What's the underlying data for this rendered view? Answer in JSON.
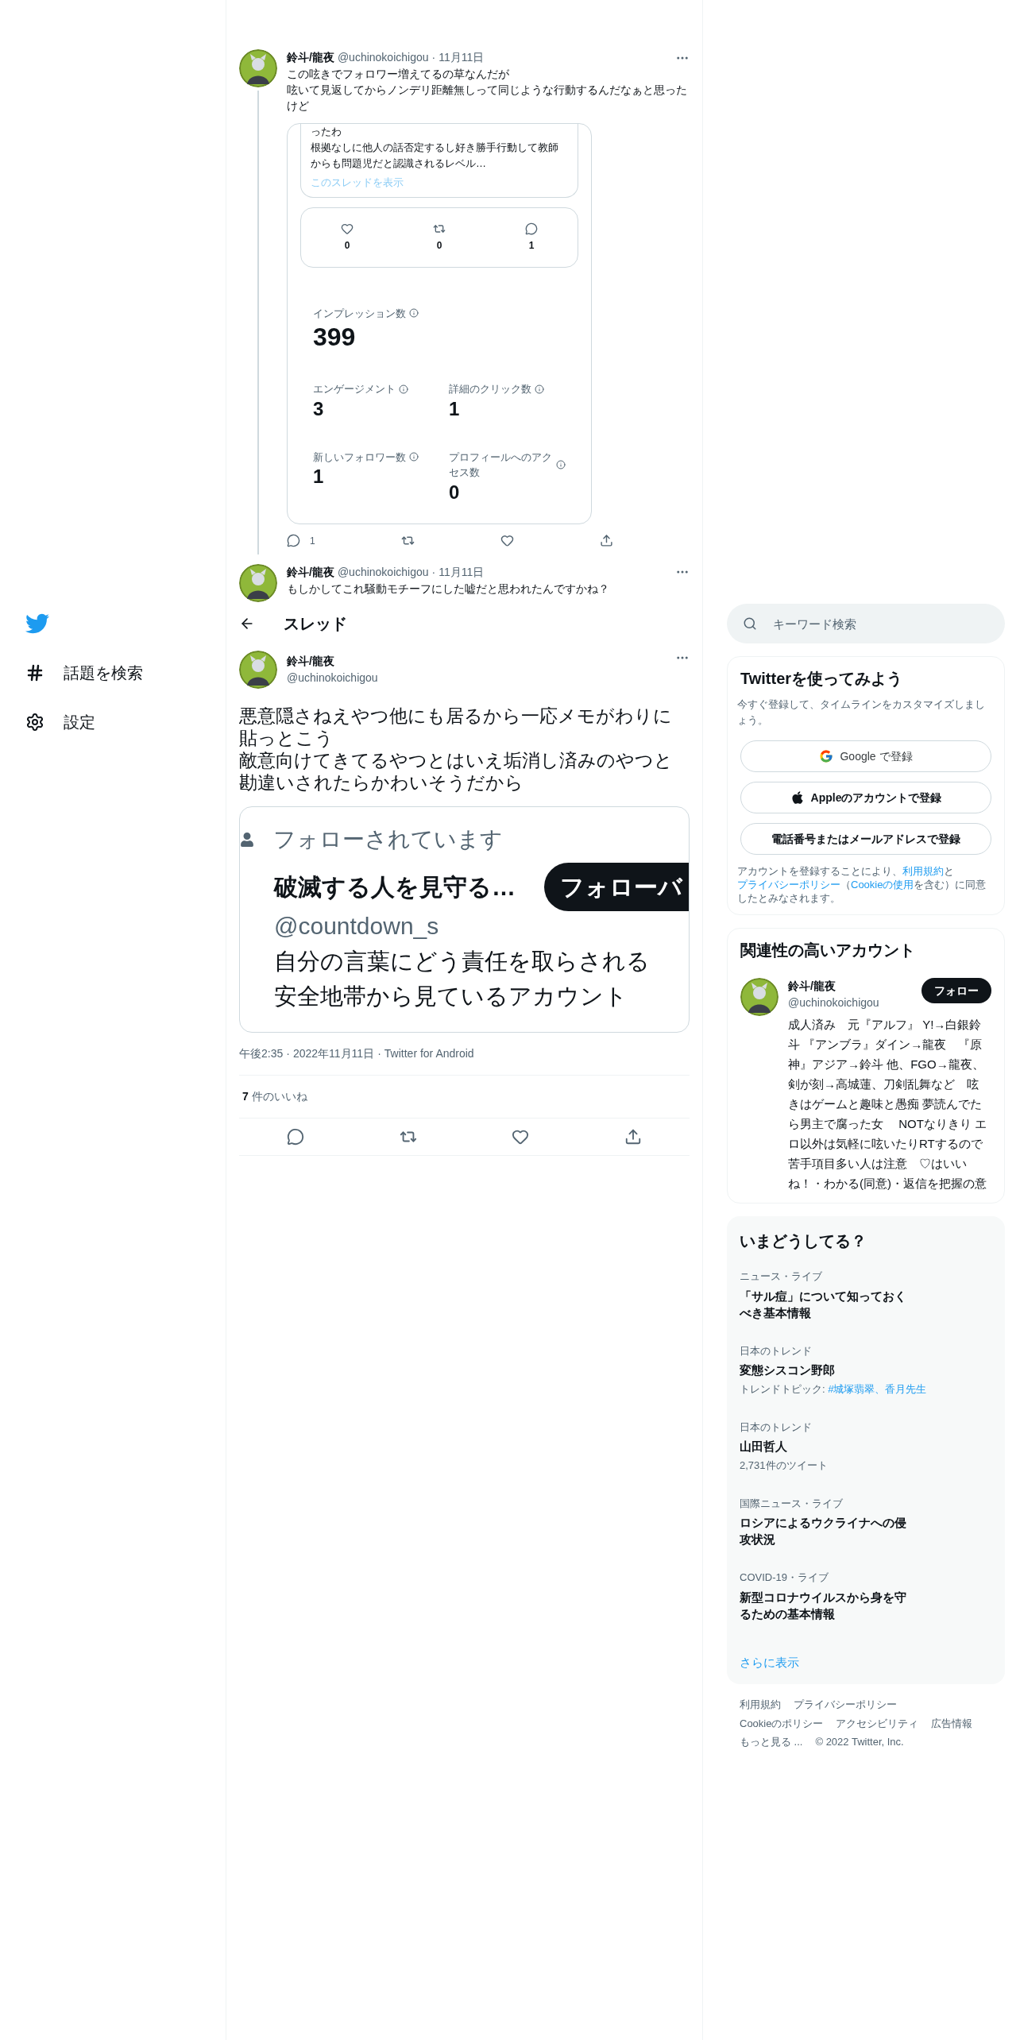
{
  "sidebar": {
    "items": [
      {
        "kind": "hashtag",
        "label": "話題を検索"
      },
      {
        "kind": "settings",
        "label": "設定"
      }
    ]
  },
  "timeline": [
    {
      "name": "鈴斗/龍夜",
      "handle": "@uchinokoichigou",
      "separator": "·",
      "date": "11月11日",
      "text": [
        "この呟きでフォロワー増えてるの草なんだが",
        "呟いて見返してからノンデリ距離無しって同じような行動するんだなぁと思ったけど"
      ],
      "screenshot": {
        "thread_text": [
          "ったわ",
          "根拠なしに他人の話否定するし好き勝手行動して教師からも問題児だと認識されるレベル…"
        ],
        "show_thread": "このスレッドを表示",
        "counts": [
          {
            "kind": "like",
            "value": "0"
          },
          {
            "kind": "retweet",
            "value": "0"
          },
          {
            "kind": "reply",
            "value": "1"
          }
        ],
        "metrics": [
          {
            "label": "インプレッション数",
            "value": "399"
          },
          {
            "label": "エンゲージメント",
            "value": "3"
          },
          {
            "label": "詳細のクリック数",
            "value": "1"
          },
          {
            "label": "新しいフォロワー数",
            "value": "1"
          },
          {
            "label": "プロフィールへのアクセス数",
            "value": "0"
          }
        ]
      },
      "actions": [
        {
          "kind": "reply",
          "count": "1"
        },
        {
          "kind": "retweet"
        },
        {
          "kind": "like"
        },
        {
          "kind": "share"
        }
      ]
    },
    {
      "name": "鈴斗/龍夜",
      "handle": "@uchinokoichigou",
      "separator": "·",
      "date": "11月11日",
      "text": [
        "もしかしてこれ騒動モチーフにした嘘だと思われたんですかね？"
      ]
    }
  ],
  "header": {
    "title": "スレッド"
  },
  "main_tweet": {
    "name": "鈴斗/龍夜",
    "handle": "@uchinokoichigou",
    "text": [
      "悪意隠さねえやつ他にも居るから一応メモがわりに貼っとこう",
      "敵意向けてきてるやつとはいえ垢消し済みのやつと勘違いされたらかわいそうだから"
    ],
    "image": {
      "followed_label": "フォローされています",
      "name": "破滅する人を見守る…",
      "handle": "@countdown_s",
      "button": "フォローバ",
      "bio": [
        "自分の言葉にどう責任を取らされる",
        "安全地帯から見ているアカウント"
      ]
    },
    "meta": [
      "午後2:35",
      "·",
      "2022年11月11日",
      "·",
      "Twitter for Android"
    ],
    "likes": {
      "count": "7",
      "label": "件のいいね"
    },
    "actions": [
      {
        "kind": "reply"
      },
      {
        "kind": "retweet"
      },
      {
        "kind": "like"
      },
      {
        "kind": "share"
      }
    ]
  },
  "search": {
    "placeholder": "キーワード検索"
  },
  "signup": {
    "title": "Twitterを使ってみよう",
    "subtitle": "今すぐ登録して、タイムラインをカスタマイズしましょう。",
    "buttons": [
      {
        "kind": "google",
        "label": "Google で登録"
      },
      {
        "kind": "apple",
        "label": "Appleのアカウントで登録"
      },
      {
        "kind": "plain",
        "label": "電話番号またはメールアドレスで登録"
      }
    ],
    "legal": [
      {
        "text": "アカウントを登録することにより、",
        "link": false
      },
      {
        "text": "利用規約",
        "link": true
      },
      {
        "text": "と",
        "link": false
      },
      {
        "text": "プライバシーポリシー",
        "link": true
      },
      {
        "text": "（",
        "link": false
      },
      {
        "text": "Cookieの使用",
        "link": true
      },
      {
        "text": "を含む）に同意したとみなされます。",
        "link": false
      }
    ]
  },
  "related": {
    "title": "関連性の高いアカウント",
    "account": {
      "name": "鈴斗/龍夜",
      "handle": "@uchinokoichigou",
      "button": "フォロー",
      "bio": "成人済み　元『アルフ』 Y!→白銀鈴斗 『アンブラ』ダイン→龍夜　『原神』アジア→鈴斗 他、FGO→龍夜、剣が刻→高城蓮、刀剣乱舞など　呟きはゲームと趣味と愚痴 夢読んでたら男主で腐った女　 NOTなりきり エロ以外は気軽に呟いたりRTするので苦手項目多い人は注意　♡はいいね！・わかる(同意)・返信を把握の意"
    }
  },
  "trends": {
    "title": "いまどうしてる？",
    "items": [
      {
        "category": "ニュース・ライブ",
        "title": "「サル痘」について知っておくべき基本情報"
      },
      {
        "category": "日本のトレンド",
        "title": "変態シスコン野郎",
        "sub": [
          {
            "text": "トレンドトピック: ",
            "link": false
          },
          {
            "text": "#城塚翡翠",
            "link": true
          },
          {
            "text": "、",
            "link": true
          },
          {
            "text": "香月先生",
            "link": true
          }
        ]
      },
      {
        "category": "日本のトレンド",
        "title": "山田哲人",
        "sub": [
          {
            "text": "2,731件のツイート",
            "link": false
          }
        ]
      },
      {
        "category": "国際ニュース・ライブ",
        "title": "ロシアによるウクライナへの侵攻状況"
      },
      {
        "category": "COVID-19・ライブ",
        "title": "新型コロナウイルスから身を守るための基本情報"
      }
    ],
    "more": "さらに表示"
  },
  "footer": [
    [
      "利用規約",
      "プライバシーポリシー"
    ],
    [
      "Cookieのポリシー",
      "アクセシビリティ",
      "広告情報"
    ],
    [
      "もっと見る ...",
      "© 2022 Twitter, Inc."
    ]
  ]
}
